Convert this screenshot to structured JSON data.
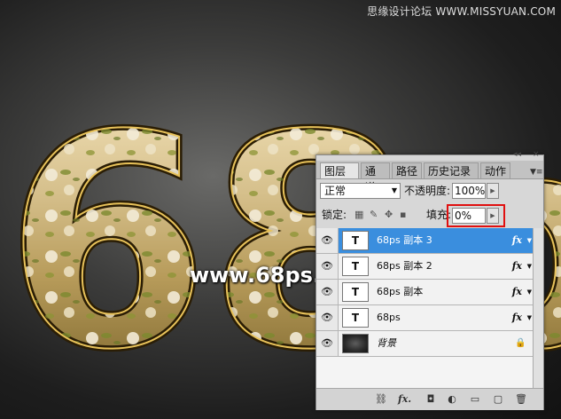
{
  "watermark": "思缘设计论坛 WWW.MISSYUAN.COM",
  "artwork": {
    "text": "68ps"
  },
  "site_label": "www.68ps.com",
  "panel": {
    "tabs": [
      {
        "label": "图层",
        "close": "×"
      },
      {
        "label": "通道"
      },
      {
        "label": "路径"
      },
      {
        "label": "历史记录"
      },
      {
        "label": "动作"
      }
    ],
    "blend_mode": "正常",
    "opacity_label": "不透明度:",
    "opacity_value": "100%",
    "lock_label": "锁定:",
    "fill_label": "填充:",
    "fill_value": "0%",
    "layers": [
      {
        "name": "68ps 副本 3",
        "thumb": "T",
        "fx": "fx",
        "selected": true
      },
      {
        "name": "68ps 副本 2",
        "thumb": "T",
        "fx": "fx"
      },
      {
        "name": "68ps 副本",
        "thumb": "T",
        "fx": "fx"
      },
      {
        "name": "68ps",
        "thumb": "T",
        "fx": "fx"
      },
      {
        "name": "背景",
        "thumb": "",
        "locked": true
      }
    ],
    "highlight_color": "#e01010",
    "selected_color": "#3a8ede"
  }
}
